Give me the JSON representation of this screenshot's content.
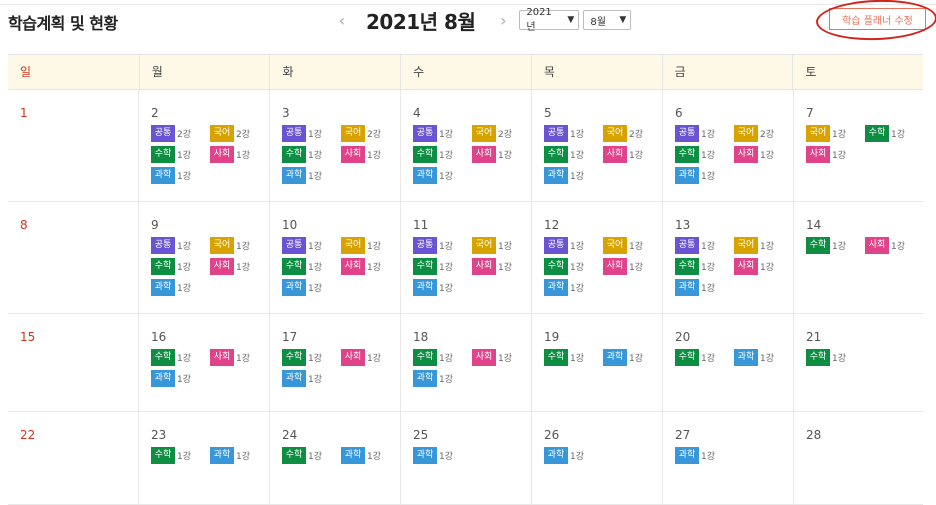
{
  "header": {
    "title": "학습계획 및 현황",
    "month_title": "2021년 8월",
    "prev_arrow": "‹",
    "next_arrow": "›",
    "year_select": "2021 년",
    "month_select": "8월",
    "edit_button": "학습 플래너 수정"
  },
  "colors": {
    "공통": "#6b54d4",
    "국어": "#d8a200",
    "수학": "#0e8e43",
    "사회": "#e0438a",
    "과학": "#3797d8",
    "accent": "#e8735a",
    "annotation": "#d0241c"
  },
  "weekdays": [
    "일",
    "월",
    "화",
    "수",
    "목",
    "금",
    "토"
  ],
  "weeks": [
    [
      {
        "day": "1",
        "lessons": []
      },
      {
        "day": "2",
        "lessons": [
          {
            "subject": "공통",
            "count": "2강"
          },
          {
            "subject": "국어",
            "count": "2강"
          },
          {
            "subject": "수학",
            "count": "1강"
          },
          {
            "subject": "사회",
            "count": "1강"
          },
          {
            "subject": "과학",
            "count": "1강"
          }
        ]
      },
      {
        "day": "3",
        "lessons": [
          {
            "subject": "공통",
            "count": "1강"
          },
          {
            "subject": "국어",
            "count": "2강"
          },
          {
            "subject": "수학",
            "count": "1강"
          },
          {
            "subject": "사회",
            "count": "1강"
          },
          {
            "subject": "과학",
            "count": "1강"
          }
        ]
      },
      {
        "day": "4",
        "lessons": [
          {
            "subject": "공통",
            "count": "1강"
          },
          {
            "subject": "국어",
            "count": "2강"
          },
          {
            "subject": "수학",
            "count": "1강"
          },
          {
            "subject": "사회",
            "count": "1강"
          },
          {
            "subject": "과학",
            "count": "1강"
          }
        ]
      },
      {
        "day": "5",
        "lessons": [
          {
            "subject": "공통",
            "count": "1강"
          },
          {
            "subject": "국어",
            "count": "2강"
          },
          {
            "subject": "수학",
            "count": "1강"
          },
          {
            "subject": "사회",
            "count": "1강"
          },
          {
            "subject": "과학",
            "count": "1강"
          }
        ]
      },
      {
        "day": "6",
        "lessons": [
          {
            "subject": "공통",
            "count": "1강"
          },
          {
            "subject": "국어",
            "count": "2강"
          },
          {
            "subject": "수학",
            "count": "1강"
          },
          {
            "subject": "사회",
            "count": "1강"
          },
          {
            "subject": "과학",
            "count": "1강"
          }
        ]
      },
      {
        "day": "7",
        "lessons": [
          {
            "subject": "국어",
            "count": "1강"
          },
          {
            "subject": "수학",
            "count": "1강"
          },
          {
            "subject": "사회",
            "count": "1강"
          }
        ]
      }
    ],
    [
      {
        "day": "8",
        "lessons": []
      },
      {
        "day": "9",
        "lessons": [
          {
            "subject": "공통",
            "count": "1강"
          },
          {
            "subject": "국어",
            "count": "1강"
          },
          {
            "subject": "수학",
            "count": "1강"
          },
          {
            "subject": "사회",
            "count": "1강"
          },
          {
            "subject": "과학",
            "count": "1강"
          }
        ]
      },
      {
        "day": "10",
        "lessons": [
          {
            "subject": "공통",
            "count": "1강"
          },
          {
            "subject": "국어",
            "count": "1강"
          },
          {
            "subject": "수학",
            "count": "1강"
          },
          {
            "subject": "사회",
            "count": "1강"
          },
          {
            "subject": "과학",
            "count": "1강"
          }
        ]
      },
      {
        "day": "11",
        "lessons": [
          {
            "subject": "공통",
            "count": "1강"
          },
          {
            "subject": "국어",
            "count": "1강"
          },
          {
            "subject": "수학",
            "count": "1강"
          },
          {
            "subject": "사회",
            "count": "1강"
          },
          {
            "subject": "과학",
            "count": "1강"
          }
        ]
      },
      {
        "day": "12",
        "lessons": [
          {
            "subject": "공통",
            "count": "1강"
          },
          {
            "subject": "국어",
            "count": "1강"
          },
          {
            "subject": "수학",
            "count": "1강"
          },
          {
            "subject": "사회",
            "count": "1강"
          },
          {
            "subject": "과학",
            "count": "1강"
          }
        ]
      },
      {
        "day": "13",
        "lessons": [
          {
            "subject": "공통",
            "count": "1강"
          },
          {
            "subject": "국어",
            "count": "1강"
          },
          {
            "subject": "수학",
            "count": "1강"
          },
          {
            "subject": "사회",
            "count": "1강"
          },
          {
            "subject": "과학",
            "count": "1강"
          }
        ]
      },
      {
        "day": "14",
        "lessons": [
          {
            "subject": "수학",
            "count": "1강"
          },
          {
            "subject": "사회",
            "count": "1강"
          }
        ]
      }
    ],
    [
      {
        "day": "15",
        "lessons": []
      },
      {
        "day": "16",
        "lessons": [
          {
            "subject": "수학",
            "count": "1강"
          },
          {
            "subject": "사회",
            "count": "1강"
          },
          {
            "subject": "과학",
            "count": "1강"
          }
        ]
      },
      {
        "day": "17",
        "lessons": [
          {
            "subject": "수학",
            "count": "1강"
          },
          {
            "subject": "사회",
            "count": "1강"
          },
          {
            "subject": "과학",
            "count": "1강"
          }
        ]
      },
      {
        "day": "18",
        "lessons": [
          {
            "subject": "수학",
            "count": "1강"
          },
          {
            "subject": "사회",
            "count": "1강"
          },
          {
            "subject": "과학",
            "count": "1강"
          }
        ]
      },
      {
        "day": "19",
        "lessons": [
          {
            "subject": "수학",
            "count": "1강"
          },
          {
            "subject": "과학",
            "count": "1강"
          }
        ]
      },
      {
        "day": "20",
        "lessons": [
          {
            "subject": "수학",
            "count": "1강"
          },
          {
            "subject": "과학",
            "count": "1강"
          }
        ]
      },
      {
        "day": "21",
        "lessons": [
          {
            "subject": "수학",
            "count": "1강"
          }
        ]
      }
    ],
    [
      {
        "day": "22",
        "lessons": []
      },
      {
        "day": "23",
        "lessons": [
          {
            "subject": "수학",
            "count": "1강"
          },
          {
            "subject": "과학",
            "count": "1강"
          }
        ]
      },
      {
        "day": "24",
        "lessons": [
          {
            "subject": "수학",
            "count": "1강"
          },
          {
            "subject": "과학",
            "count": "1강"
          }
        ]
      },
      {
        "day": "25",
        "lessons": [
          {
            "subject": "과학",
            "count": "1강"
          }
        ]
      },
      {
        "day": "26",
        "lessons": [
          {
            "subject": "과학",
            "count": "1강"
          }
        ]
      },
      {
        "day": "27",
        "lessons": [
          {
            "subject": "과학",
            "count": "1강"
          }
        ]
      },
      {
        "day": "28",
        "lessons": []
      }
    ]
  ]
}
